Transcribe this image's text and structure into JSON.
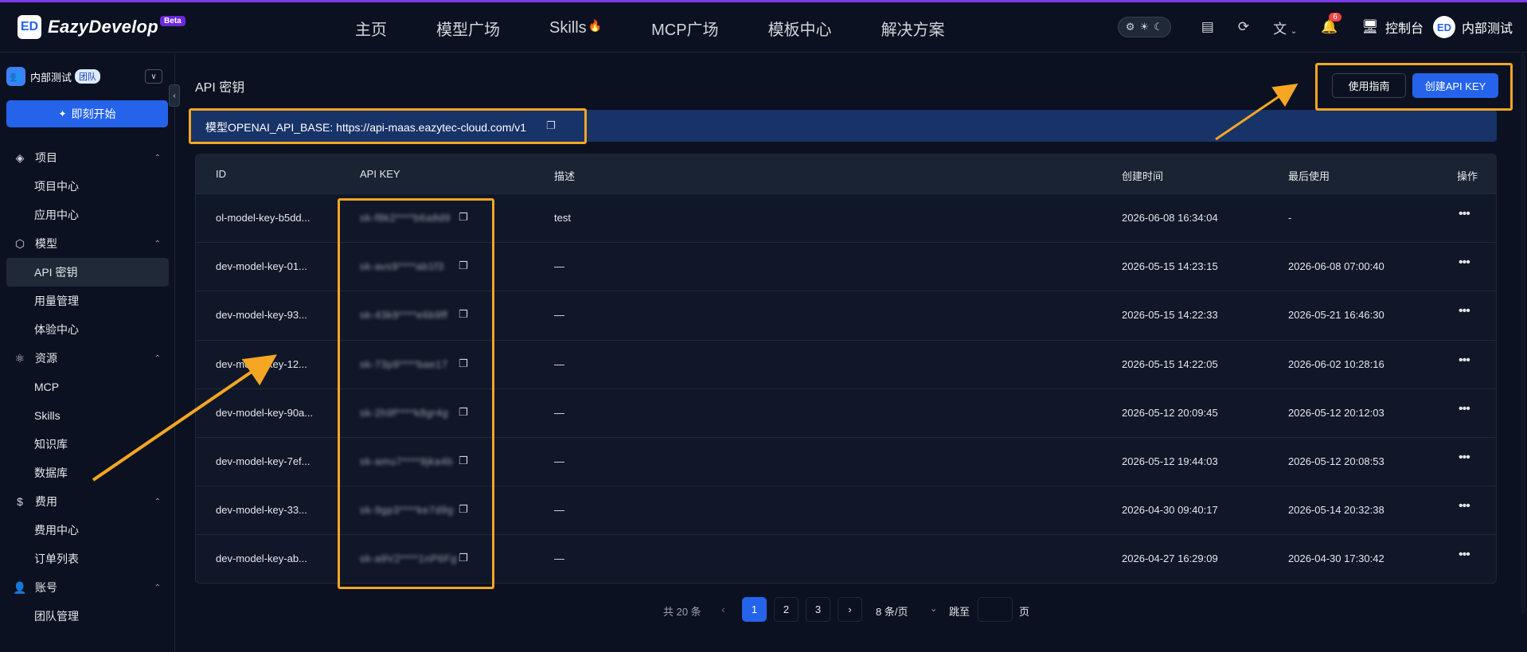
{
  "topbar": {
    "brand": "EazyDevelop",
    "beta": "Beta",
    "logo_glyph": "ED",
    "nav": [
      "主页",
      "模型广场",
      "Skills",
      "MCP广场",
      "模板中心",
      "解决方案"
    ],
    "theme_icons": [
      "system",
      "light",
      "dark"
    ],
    "notification_count": "6",
    "console_label": "控制台",
    "user_name": "内部测试",
    "accent_color": "#7c3aed"
  },
  "sidebar": {
    "team_name": "内部测试",
    "team_badge": "团队",
    "start_button": "即刻开始",
    "groups": [
      {
        "label": "项目",
        "icon": "layers-icon",
        "items": [
          "项目中心",
          "应用中心"
        ]
      },
      {
        "label": "模型",
        "icon": "cube-icon",
        "items": [
          "API 密钥",
          "用量管理",
          "体验中心"
        ]
      },
      {
        "label": "资源",
        "icon": "atom-icon",
        "items": [
          "MCP",
          "Skills",
          "知识库",
          "数据库"
        ]
      },
      {
        "label": "费用",
        "icon": "dollar-icon",
        "items": [
          "费用中心",
          "订单列表"
        ]
      },
      {
        "label": "账号",
        "icon": "user-icon",
        "items": [
          "团队管理"
        ]
      }
    ],
    "active_item": "API 密钥"
  },
  "main": {
    "title": "API 密钥",
    "guide_button": "使用指南",
    "create_button": "创建API KEY",
    "base_url_text": "模型OPENAI_API_BASE: https://api-maas.eazytec-cloud.com/v1",
    "table": {
      "headers": {
        "id": "ID",
        "key": "API KEY",
        "desc": "描述",
        "created": "创建时间",
        "last_used": "最后使用",
        "ops": "操作"
      },
      "rows": [
        {
          "id": "ol-model-key-b5dd...",
          "key": "sk-f8k2****b6a8d9",
          "desc": "test",
          "created": "2026-06-08 16:34:04",
          "last_used": "-"
        },
        {
          "id": "dev-model-key-01...",
          "key": "sk-avs9****ab1f3",
          "desc": "—",
          "created": "2026-05-15 14:23:15",
          "last_used": "2026-06-08 07:00:40"
        },
        {
          "id": "dev-model-key-93...",
          "key": "sk-43k9****e6b9ff",
          "desc": "—",
          "created": "2026-05-15 14:22:33",
          "last_used": "2026-05-21 16:46:30"
        },
        {
          "id": "dev-model-key-12...",
          "key": "sk-73p9****bae17",
          "desc": "—",
          "created": "2026-05-15 14:22:05",
          "last_used": "2026-06-02 10:28:16"
        },
        {
          "id": "dev-model-key-90a...",
          "key": "sk-2h9f****k8gr4g",
          "desc": "—",
          "created": "2026-05-12 20:09:45",
          "last_used": "2026-05-12 20:12:03"
        },
        {
          "id": "dev-model-key-7ef...",
          "key": "sk-amu7****9jka4b",
          "desc": "—",
          "created": "2026-05-12 19:44:03",
          "last_used": "2026-05-12 20:08:53"
        },
        {
          "id": "dev-model-key-33...",
          "key": "sk-9gp3****ke7d9g",
          "desc": "—",
          "created": "2026-04-30 09:40:17",
          "last_used": "2026-05-14 20:32:38"
        },
        {
          "id": "dev-model-key-ab...",
          "key": "sk-a9V2****1nP6Fg",
          "desc": "—",
          "created": "2026-04-27 16:29:09",
          "last_used": "2026-04-30 17:30:42"
        }
      ]
    },
    "pagination": {
      "total": "共 20 条",
      "pages": [
        "1",
        "2",
        "3"
      ],
      "current": "1",
      "per_page": "8 条/页",
      "jump_label": "跳至",
      "page_suffix": "页"
    }
  }
}
